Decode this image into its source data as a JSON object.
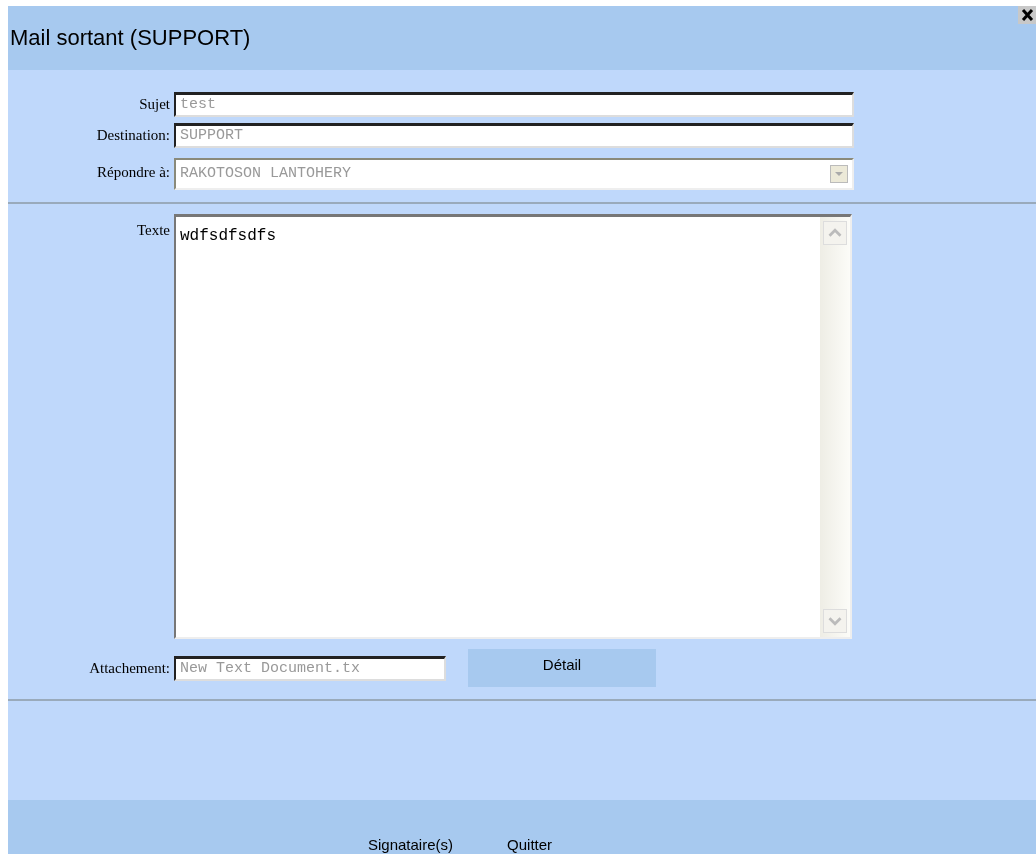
{
  "window": {
    "title": "Mail sortant (SUPPORT)"
  },
  "fields": [
    {
      "label": "Sujet",
      "value": "test",
      "kind": "text",
      "disabled": true
    },
    {
      "label": "Destination:",
      "value": "SUPPORT",
      "kind": "text",
      "disabled": true
    },
    {
      "label": "Répondre à:",
      "value": "RAKOTOSON LANTOHERY",
      "kind": "select",
      "disabled": true
    }
  ],
  "message": {
    "label": "Texte",
    "value": "wdfsdfsdfs",
    "disabled": false
  },
  "attachment": {
    "label": "Attachement:",
    "value": "New Text Document.tx",
    "disabled": true,
    "button": "Détail"
  },
  "footer_buttons": [
    "Signataire(s)",
    "Quitter"
  ]
}
